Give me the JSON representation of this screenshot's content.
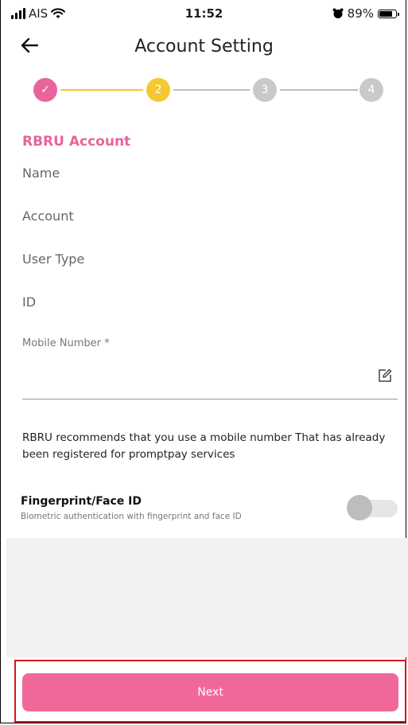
{
  "status_bar": {
    "carrier": "AIS",
    "time": "11:52",
    "battery": "89%"
  },
  "header": {
    "title": "Account Setting"
  },
  "stepper": {
    "steps": [
      "✓",
      "2",
      "3",
      "4"
    ],
    "colors": {
      "done": "#e8649a",
      "active": "#f5c832",
      "inactive": "#c9c9c9",
      "line_done": "#f5c832",
      "line_inactive": "#bdbdbd"
    }
  },
  "form": {
    "section_title": "RBRU Account",
    "fields": [
      "Name",
      "Account",
      "User Type",
      "ID"
    ],
    "mobile_label": "Mobile Number *",
    "mobile_value": "",
    "note": "RBRU recommends that you use a mobile number That has already been registered for promptpay services"
  },
  "biometric": {
    "title": "Fingerprint/Face ID",
    "subtitle": "Biometric authentication with fingerprint and face ID",
    "enabled": false
  },
  "footer": {
    "next_label": "Next"
  },
  "colors": {
    "accent": "#e8649a",
    "button": "#f0689a",
    "highlight_border": "#d9121c"
  }
}
